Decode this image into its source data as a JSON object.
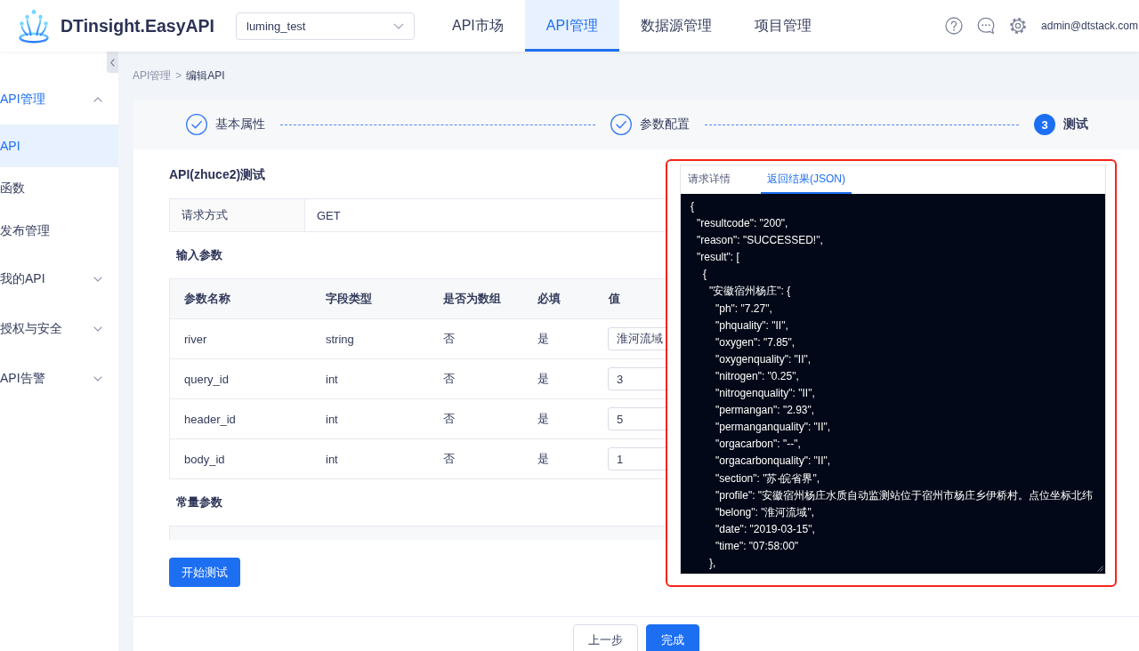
{
  "header": {
    "product_name": "DTinsight.EasyAPI",
    "project_select": {
      "value": "luming_test"
    },
    "nav_tabs": [
      {
        "label": "API市场",
        "selected": false
      },
      {
        "label": "API管理",
        "selected": true
      },
      {
        "label": "数据源管理",
        "selected": false
      },
      {
        "label": "项目管理",
        "selected": false
      }
    ],
    "user": "admin@dtstack.com"
  },
  "sidebar": {
    "items": [
      {
        "label": "API管理",
        "expanded": true,
        "children": [
          {
            "label": "API",
            "selected": true
          },
          {
            "label": "函数",
            "selected": false
          },
          {
            "label": "发布管理",
            "selected": false
          }
        ]
      },
      {
        "label": "我的API",
        "expanded": false
      },
      {
        "label": "授权与安全",
        "expanded": false
      },
      {
        "label": "API告警",
        "expanded": false
      }
    ]
  },
  "breadcrumb": {
    "items": [
      {
        "label": "API管理",
        "current": false
      },
      {
        "label": "编辑API",
        "current": true
      }
    ],
    "separator": ">"
  },
  "steps": [
    {
      "label": "基本属性",
      "completed": true,
      "current": false
    },
    {
      "label": "参数配置",
      "completed": true,
      "current": false
    },
    {
      "label": "测试",
      "number": "3",
      "completed": false,
      "current": true
    }
  ],
  "test_form": {
    "title": "API(zhuce2)测试",
    "request_method": {
      "label": "请求方式",
      "value": "GET"
    },
    "input_params": {
      "heading": "输入参数",
      "columns": [
        "参数名称",
        "字段类型",
        "是否为数组",
        "必填",
        "值"
      ],
      "rows": [
        {
          "name": "river",
          "type": "string",
          "is_array": "否",
          "required": "是",
          "value": "淮河流域"
        },
        {
          "name": "query_id",
          "type": "int",
          "is_array": "否",
          "required": "是",
          "value": "3"
        },
        {
          "name": "header_id",
          "type": "int",
          "is_array": "否",
          "required": "是",
          "value": "5"
        },
        {
          "name": "body_id",
          "type": "int",
          "is_array": "否",
          "required": "是",
          "value": "1"
        }
      ]
    },
    "constant_params": {
      "heading": "常量参数"
    },
    "start_button": "开始测试"
  },
  "result_panel": {
    "tabs": [
      {
        "label": "请求详情",
        "selected": false
      },
      {
        "label": "返回结果(JSON)",
        "selected": true
      }
    ],
    "code": [
      {
        "text": "{",
        "children": [
          {
            "text": "\"resultcode\": \"200\","
          },
          {
            "text": "\"reason\": \"SUCCESSED!\","
          },
          {
            "text": "\"result\": [",
            "children": [
              {
                "text": "{",
                "children": [
                  {
                    "text": "\"安徽宿州杨庄\": {",
                    "children": [
                      {
                        "text": "\"ph\": \"7.27\","
                      },
                      {
                        "text": "\"phquality\": \"II\","
                      },
                      {
                        "text": "\"oxygen\": \"7.85\","
                      },
                      {
                        "text": "\"oxygenquality\": \"II\","
                      },
                      {
                        "text": "\"nitrogen\": \"0.25\","
                      },
                      {
                        "text": "\"nitrogenquality\": \"II\","
                      },
                      {
                        "text": "\"permangan\": \"2.93\","
                      },
                      {
                        "text": "\"permanganquality\": \"II\","
                      },
                      {
                        "text": "\"orgacarbon\": \"--\","
                      },
                      {
                        "text": "\"orgacarbonquality\": \"II\","
                      },
                      {
                        "text": "\"section\": \"苏-皖省界\","
                      },
                      {
                        "text": "\"profile\": \"安徽宿州杨庄水质自动监测站位于宿州市杨庄乡伊桥村。点位坐标北纬"
                      },
                      {
                        "text": "\"belong\": \"淮河流域\","
                      },
                      {
                        "text": "\"date\": \"2019-03-15\","
                      },
                      {
                        "text": "\"time\": \"07:58:00\""
                      }
                    ]
                  },
                  {
                    "text": "},"
                  }
                ]
              }
            ]
          }
        ]
      }
    ]
  },
  "footer": {
    "buttons": [
      {
        "label": "上一步",
        "kind": "default"
      },
      {
        "label": "完成",
        "kind": "primary"
      }
    ]
  }
}
